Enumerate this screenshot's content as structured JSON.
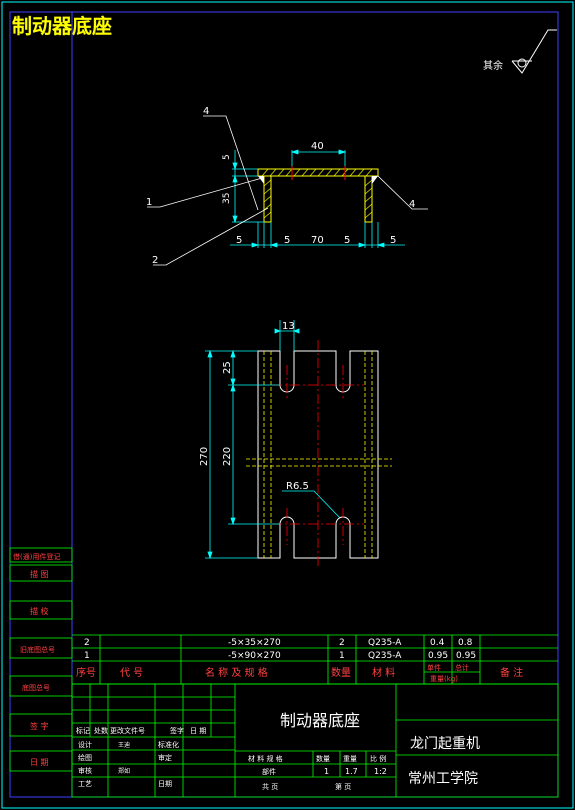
{
  "title": "制动器底座",
  "roughness_note": "其余",
  "dims": {
    "d40": "40",
    "d5_top": "5",
    "d35": "35",
    "d5_a": "5",
    "d5_b": "5",
    "d70": "70",
    "d5_c": "5",
    "d5_d": "5",
    "d13": "13",
    "d25": "25",
    "d220": "220",
    "d270": "270",
    "r65": "R6.5"
  },
  "leaders": {
    "l4_left": "4",
    "l1": "1",
    "l2": "2",
    "l4_right": "4"
  },
  "bom_rows": [
    {
      "no": "2",
      "code": "",
      "name": "-5×35×270",
      "qty": "2",
      "material": "Q235-A",
      "w_single": "0.4",
      "w_total": "0.8",
      "remark": ""
    },
    {
      "no": "1",
      "code": "",
      "name": "-5×90×270",
      "qty": "1",
      "material": "Q235-A",
      "w_single": "0.95",
      "w_total": "0.95",
      "remark": ""
    }
  ],
  "bom_header": {
    "no": "序号",
    "code": "代 号",
    "name": "名 称 及 规 格",
    "qty": "数量",
    "material": "材 料",
    "w_single": "单件",
    "w_total": "总计",
    "weight": "重量(kg)",
    "remark": "备 注"
  },
  "title_block": {
    "drawing_name": "制动器底座",
    "product": "龙门起重机",
    "school": "常州工学院",
    "rev_headers": [
      "标记",
      "处数",
      "更改文件号",
      "签字",
      "日 期"
    ],
    "roles": [
      "设计",
      "绘图",
      "审核",
      "工艺"
    ],
    "role_values": [
      "王迪",
      "",
      "郑如",
      ""
    ],
    "std_label": "标准化",
    "approve_label": "审定",
    "date_label": "日期",
    "mat_spec": "材 料 规 格",
    "qty_label": "数量",
    "weight_label": "重量",
    "scale_label": "比 例",
    "part_type": "部件",
    "qty_val": "1",
    "weight_val": "1.7",
    "scale_val": "1:2",
    "sheets_total": "共  页",
    "sheet_no": "第  页"
  },
  "side_labels": [
    "借(通)用件登记",
    "描 图",
    "描 校",
    "旧底图总号",
    "底图总号",
    "签 字",
    "日 期"
  ],
  "colors": {
    "border": "#00ffff",
    "frame": "#4040ff",
    "part": "#ffff00",
    "dim": "#00ffff",
    "center": "#ff0000",
    "text": "#ffffff",
    "table": "#00ff00"
  }
}
